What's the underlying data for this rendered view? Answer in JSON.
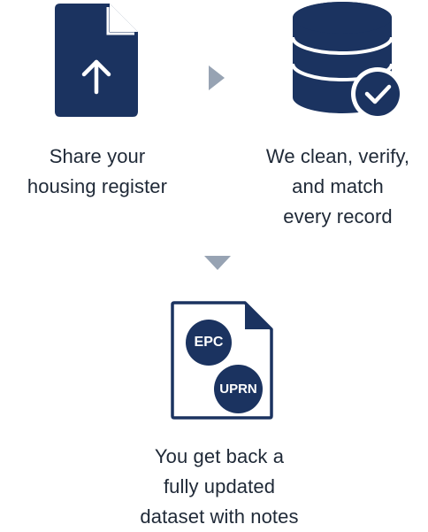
{
  "colors": {
    "navy": "#1b3360",
    "arrow_gray": "#97a3b3",
    "text": "#1f2937"
  },
  "steps": [
    {
      "icon": "upload-document-icon",
      "caption_lines": [
        "Share your",
        "housing register"
      ]
    },
    {
      "icon": "database-check-icon",
      "caption_lines": [
        "We clean, verify,",
        "and match",
        "every record"
      ]
    },
    {
      "icon": "document-badges-icon",
      "badges": [
        "EPC",
        "UPRN"
      ],
      "caption_lines": [
        "You get back a",
        "fully updated",
        "dataset with notes"
      ]
    }
  ],
  "connectors": [
    {
      "icon": "arrow-right-icon"
    },
    {
      "icon": "arrow-down-icon"
    }
  ]
}
